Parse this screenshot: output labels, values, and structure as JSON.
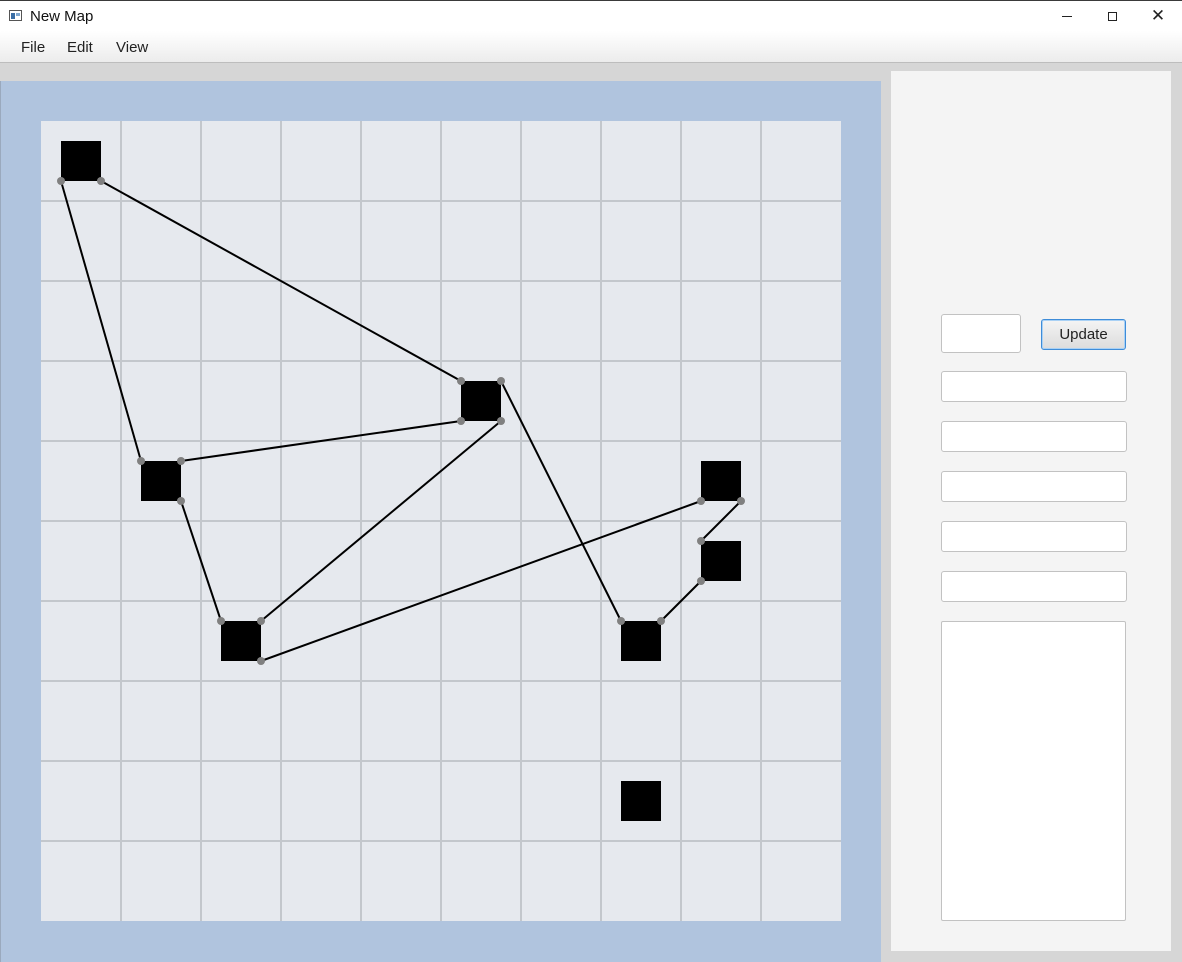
{
  "window": {
    "title": "New Map",
    "icon": "app-window-icon",
    "controls": [
      "minimize-icon",
      "maximize-icon",
      "close-icon"
    ]
  },
  "menu": {
    "file": "File",
    "edit": "Edit",
    "view": "View"
  },
  "map": {
    "grid": {
      "columns": 10,
      "rows": 10
    },
    "colors": {
      "frame": "#b0c4de",
      "cell": "#e6e9ee",
      "grid_line": "#c3c7cc",
      "node": "#000000",
      "port": "#808080",
      "edge": "#000000"
    },
    "nodes": [
      {
        "id": "n1",
        "col": 0,
        "row": 0
      },
      {
        "id": "n2",
        "col": 5,
        "row": 3
      },
      {
        "id": "n3",
        "col": 1,
        "row": 4
      },
      {
        "id": "n4",
        "col": 8,
        "row": 4
      },
      {
        "id": "n5",
        "col": 8,
        "row": 5
      },
      {
        "id": "n6",
        "col": 2,
        "row": 6
      },
      {
        "id": "n7",
        "col": 7,
        "row": 6
      },
      {
        "id": "n8",
        "col": 7,
        "row": 8
      }
    ],
    "edges": [
      {
        "from": "n1",
        "from_corner": "bl",
        "to": "n3",
        "to_corner": "tl"
      },
      {
        "from": "n1",
        "from_corner": "br",
        "to": "n2",
        "to_corner": "tl"
      },
      {
        "from": "n3",
        "from_corner": "tr",
        "to": "n2",
        "to_corner": "bl"
      },
      {
        "from": "n3",
        "from_corner": "br",
        "to": "n6",
        "to_corner": "tl"
      },
      {
        "from": "n6",
        "from_corner": "tr",
        "to": "n2",
        "to_corner": "br"
      },
      {
        "from": "n6",
        "from_corner": "br",
        "to": "n4",
        "to_corner": "bl"
      },
      {
        "from": "n2",
        "from_corner": "tr",
        "to": "n7",
        "to_corner": "tl"
      },
      {
        "from": "n7",
        "from_corner": "tr",
        "to": "n5",
        "to_corner": "bl"
      },
      {
        "from": "n5",
        "from_corner": "tl",
        "to": "n4",
        "to_corner": "br"
      }
    ]
  },
  "panel": {
    "update_button": "Update",
    "small_field_value": "",
    "fields": [
      "",
      "",
      "",
      "",
      ""
    ],
    "text_area_value": ""
  }
}
